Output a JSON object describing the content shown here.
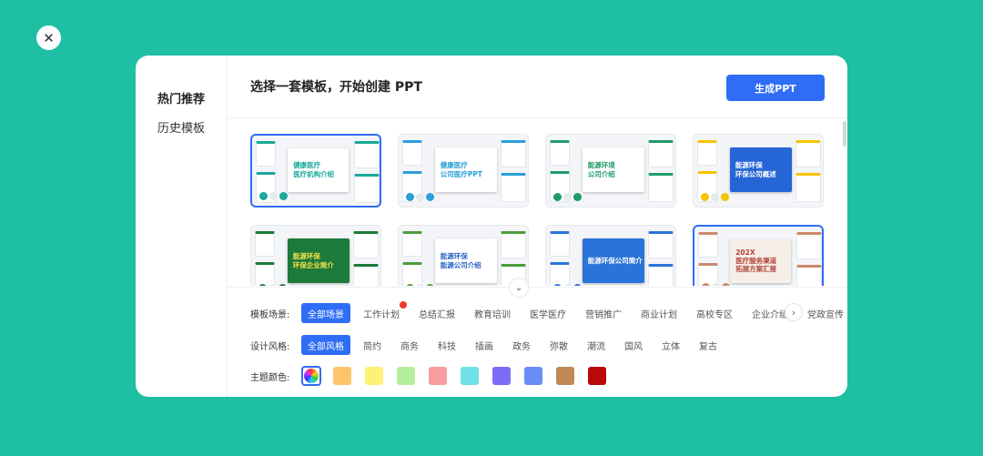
{
  "close_icon": "close-icon",
  "sidebar": {
    "items": [
      {
        "label": "热门推荐",
        "active": true
      },
      {
        "label": "历史模板",
        "active": false
      }
    ]
  },
  "header": {
    "title": "选择一套模板，开始创建 PPT",
    "generate_button": "生成PPT"
  },
  "templates": [
    {
      "name": "template-1",
      "hero_text": [
        "健康医疗",
        "医疗机构介绍"
      ],
      "hero_bg": "#ffffff",
      "text_color": "#18a99b",
      "accent": "#18a99b",
      "selected": true
    },
    {
      "name": "template-2",
      "hero_text": [
        "健康医疗",
        "公司医疗PPT"
      ],
      "hero_bg": "#ffffff",
      "text_color": "#2a9fd8",
      "accent": "#2a9fd8",
      "selected": false
    },
    {
      "name": "template-3",
      "hero_text": [
        "能源环境",
        "公司介绍"
      ],
      "hero_bg": "#ffffff",
      "text_color": "#1e9b6a",
      "accent": "#1e9b6a",
      "selected": false
    },
    {
      "name": "template-4",
      "hero_text": [
        "能源环保",
        "环保公司概述"
      ],
      "hero_bg": "#2565d6",
      "text_color": "#ffffff",
      "accent": "#f6c400",
      "selected": false
    },
    {
      "name": "template-5",
      "hero_text": [
        "能源环保",
        "环保企业简介"
      ],
      "hero_bg": "#1c7a3a",
      "text_color": "#f7e24a",
      "accent": "#1c7a3a",
      "selected": false
    },
    {
      "name": "template-6",
      "hero_text": [
        "能源环保",
        "能源公司介绍"
      ],
      "hero_bg": "#ffffff",
      "text_color": "#2a63c5",
      "accent": "#4a9d3b",
      "selected": false
    },
    {
      "name": "template-7",
      "hero_text": [
        "能源环保公司简介",
        ""
      ],
      "hero_bg": "#2a73d9",
      "text_color": "#ffffff",
      "accent": "#2a73d9",
      "selected": false
    },
    {
      "name": "template-8",
      "hero_text": [
        "202X",
        "医疗服务渠道",
        "拓展方案汇报"
      ],
      "hero_bg": "#f6efe8",
      "text_color": "#b0453a",
      "accent": "#c98a6b",
      "selected": true
    }
  ],
  "filters": {
    "scene": {
      "label": "模板场景:",
      "options": [
        "全部场景",
        "工作计划",
        "总结汇报",
        "教育培训",
        "医学医疗",
        "营销推广",
        "商业计划",
        "高校专区",
        "企业介绍",
        "党政宣传"
      ],
      "active": 0,
      "hot": 1
    },
    "style": {
      "label": "设计风格:",
      "options": [
        "全部风格",
        "简约",
        "商务",
        "科技",
        "插画",
        "政务",
        "弥散",
        "潮流",
        "国风",
        "立体",
        "复古"
      ],
      "active": 0
    },
    "color": {
      "label": "主题颜色:",
      "swatches": [
        "#ffc46b",
        "#fff176",
        "#b5ef9c",
        "#f79d9d",
        "#6fe2ea",
        "#7b6df7",
        "#6c8cf8",
        "#bf8a55",
        "#b90808"
      ]
    }
  },
  "icons": {
    "expand": "chevron-down-icon",
    "next": "chevron-right-icon"
  }
}
